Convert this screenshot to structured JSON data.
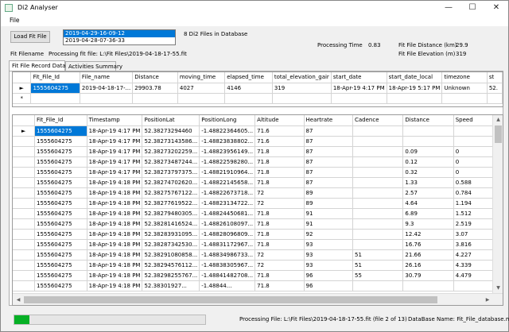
{
  "window": {
    "title": "Di2 Analyser"
  },
  "menu": {
    "file": "File"
  },
  "controls": {
    "load_button": "Load Fit File",
    "file_list": [
      "2019-04-29-16-09-12",
      "2019-04-28-07-36-33"
    ],
    "file_list_selected_index": 0,
    "files_in_db": "8 Di2 Files in Database",
    "fit_filename_label": "Fit Filename",
    "processing_fit_file": "Processing fit file:  L:\\Fit Files\\2019-04-18-17-55.fit",
    "processing_time_label": "Processing Time",
    "processing_time_value": "0.83",
    "fit_distance_label": "Fit File Distance (km)",
    "fit_distance_value": "29.9",
    "fit_elevation_label": "Fit File Elevation (m)",
    "fit_elevation_value": "319"
  },
  "tabs": [
    "Fit File Record Data",
    "Activities Summary"
  ],
  "summary_grid": {
    "columns": [
      "Fit_File_Id",
      "File_name",
      "Distance",
      "moving_time",
      "elapsed_time",
      "total_elevation_gair",
      "start_date",
      "start_date_local",
      "timezone",
      "st"
    ],
    "rows": [
      [
        "1555604275",
        "2019-04-18-17-...",
        "29903.78",
        "4027",
        "4146",
        "319",
        "18-Apr-19 4:17 PM",
        "18-Apr-19 5:17 PM",
        "Unknown",
        "52."
      ]
    ],
    "row_markers": [
      "►",
      "*"
    ]
  },
  "record_grid": {
    "columns": [
      "Fit_File_Id",
      "Timestamp",
      "PositionLat",
      "PositionLong",
      "Altitude",
      "Heartrate",
      "Cadence",
      "Distance",
      "Speed"
    ],
    "rows": [
      [
        "1555604275",
        "18-Apr-19 4:17 PM",
        "52.38273294460",
        "-1.48822364605...",
        "71.6",
        "87",
        "",
        "",
        ""
      ],
      [
        "1555604275",
        "18-Apr-19 4:17 PM",
        "52.38273143586...",
        "-1.48823838802...",
        "71.6",
        "87",
        "",
        "",
        ""
      ],
      [
        "1555604275",
        "18-Apr-19 4:17 PM",
        "52.38273202259...",
        "-1.48823956149...",
        "71.8",
        "87",
        "",
        "0.09",
        "0"
      ],
      [
        "1555604275",
        "18-Apr-19 4:17 PM",
        "52.38273487244...",
        "-1.48822598280...",
        "71.8",
        "87",
        "",
        "0.12",
        "0"
      ],
      [
        "1555604275",
        "18-Apr-19 4:17 PM",
        "52.38273797375...",
        "-1.48821910964...",
        "71.8",
        "87",
        "",
        "0.32",
        "0"
      ],
      [
        "1555604275",
        "18-Apr-19 4:18 PM",
        "52.38274702620...",
        "-1.48822145658...",
        "71.8",
        "87",
        "",
        "1.33",
        "0.588"
      ],
      [
        "1555604275",
        "18-Apr-19 4:18 PM",
        "52.38275767122...",
        "-1.48822673718...",
        "72",
        "89",
        "",
        "2.57",
        "0.784"
      ],
      [
        "1555604275",
        "18-Apr-19 4:18 PM",
        "52.38277619522...",
        "-1.48823134722...",
        "72",
        "89",
        "",
        "4.64",
        "1.194"
      ],
      [
        "1555604275",
        "18-Apr-19 4:18 PM",
        "52.38279480305...",
        "-1.48824450681...",
        "71.8",
        "91",
        "",
        "6.89",
        "1.512"
      ],
      [
        "1555604275",
        "18-Apr-19 4:18 PM",
        "52.38281416524...",
        "-1.48826108097...",
        "71.8",
        "91",
        "",
        "9.3",
        "2.519"
      ],
      [
        "1555604275",
        "18-Apr-19 4:18 PM",
        "52.38283931095...",
        "-1.48828096809...",
        "71.8",
        "92",
        "",
        "12.42",
        "3.07"
      ],
      [
        "1555604275",
        "18-Apr-19 4:18 PM",
        "52.38287342530...",
        "-1.48831172967...",
        "71.8",
        "93",
        "",
        "16.76",
        "3.816"
      ],
      [
        "1555604275",
        "18-Apr-19 4:18 PM",
        "52.38291080858...",
        "-1.48834986733...",
        "72",
        "93",
        "51",
        "21.66",
        "4.227"
      ],
      [
        "1555604275",
        "18-Apr-19 4:18 PM",
        "52.38294576112...",
        "-1.48838305967...",
        "72",
        "93",
        "51",
        "26.16",
        "4.339"
      ],
      [
        "1555604275",
        "18-Apr-19 4:18 PM",
        "52.38298255767...",
        "-1.48841482708...",
        "71.8",
        "96",
        "55",
        "30.79",
        "4.479"
      ],
      [
        "1555604275",
        "18-Apr-19 4:18 PM",
        "52.38301927...",
        "-1.48844...",
        "71.8",
        "96",
        "",
        "",
        ""
      ]
    ]
  },
  "status": {
    "progress_fraction": 0.08,
    "processing_file": "Processing File:  L:\\Fit Files\\2019-04-18-17-55.fit (file 2 of 13)",
    "database_name": "DataBase Name: Fit_File_database.mdf"
  },
  "colors": {
    "selection": "#0078d7",
    "progress": "#06b025"
  }
}
